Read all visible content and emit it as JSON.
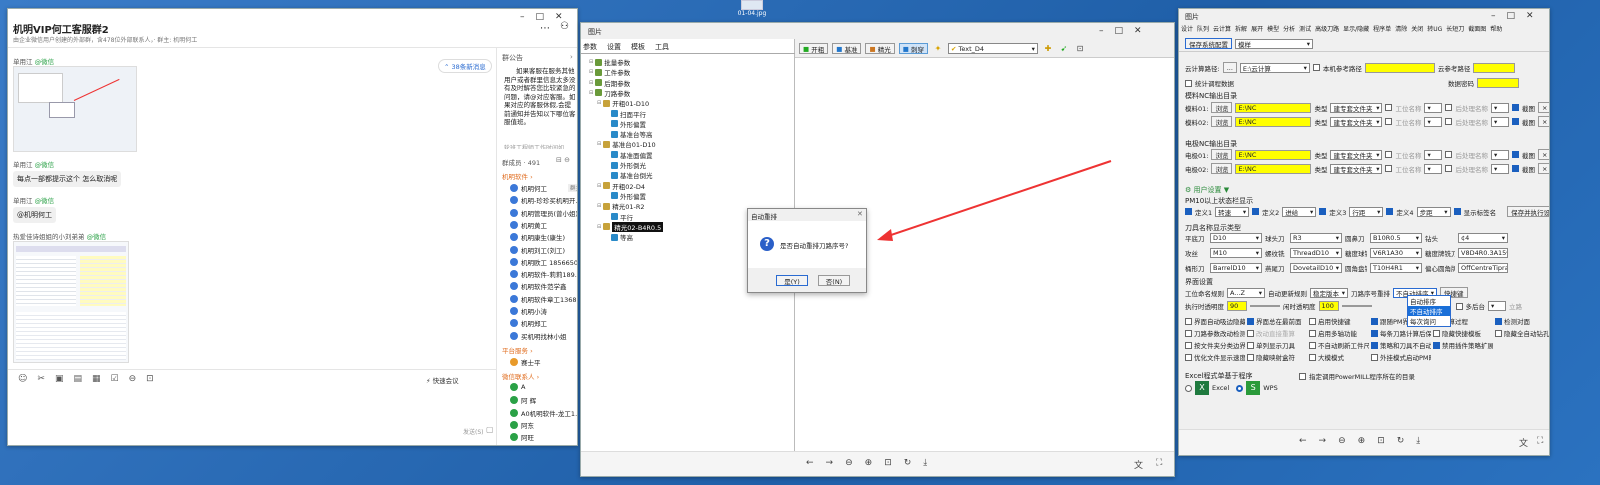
{
  "desktop_file_label": "01-04.jpg",
  "chat": {
    "title": "机明VIP何工客服群2",
    "subtitle": "由企业微信用户创建的外部群，含478位外部联系人，· 群主: 机明何工",
    "new_msgs": "38条新消息",
    "msgs": [
      {
        "sender": "单用江",
        "tag": "@微信"
      },
      {
        "sender": "单用江",
        "tag": "@微信",
        "text": "每点一部都提示这个 怎么取消呢"
      },
      {
        "sender": "单用江",
        "tag": "@微信",
        "text": "@机明何工"
      },
      {
        "sender": "热爱佳诗姐姐的小刘弟弟",
        "tag": "@微信"
      }
    ],
    "quick_meeting": "快速会议",
    "send_hint": "发送(S)",
    "notice_title": "群公告",
    "notice_text": "如果客服在服务其他用户或者群里信息太多没有及时解答您比较紧急的问题，请@对应客服。如果对应的客服休假,会提前通知并告知以下哪位客服值班。",
    "notice_more": "轮班工程师工作时间如",
    "members_title": "群成员 · 491",
    "group_software": "机明软件",
    "members": [
      "机明何工",
      "机明-珍珍买机明开...",
      "机明管理员(曾小姐)",
      "机明黄工",
      "机明康生(康生)",
      "机明刘工(刘工)",
      "机明欧工 1856650...",
      "机明软件-莉莉189...",
      "机明软件范学鑫",
      "机明软件章工1368...",
      "机明小涛",
      "机明郑工",
      "买机明找林小姐"
    ],
    "owner_tag": "群主",
    "group_platform": "平台服务",
    "platform_members": [
      "赛士平"
    ],
    "group_wechat": "微信联系人",
    "wechat_members": [
      "A",
      "阿 辉",
      "A0机明软件-龙工1...",
      "阿东",
      "阿旺"
    ]
  },
  "imgwin": {
    "title": "图片",
    "tabs": [
      "参数",
      "设置",
      "模板",
      "工具"
    ],
    "toolbar": [
      "开粗",
      "基准",
      "精光",
      "刺穿"
    ],
    "select_value": "Text_D4",
    "tree": [
      {
        "label": "批量参数",
        "lvl": 1
      },
      {
        "label": "工件参数",
        "lvl": 1
      },
      {
        "label": "后期参数",
        "lvl": 1
      },
      {
        "label": "刀路参数",
        "lvl": 1
      },
      {
        "label": "开粗01-D10",
        "lvl": 2
      },
      {
        "label": "扫面平行",
        "lvl": 3
      },
      {
        "label": "外形偏置",
        "lvl": 3
      },
      {
        "label": "基准台等高",
        "lvl": 3
      },
      {
        "label": "基准台01-D10",
        "lvl": 2
      },
      {
        "label": "基准面偏置",
        "lvl": 3
      },
      {
        "label": "外形倒光",
        "lvl": 3
      },
      {
        "label": "基准台倒光",
        "lvl": 3
      },
      {
        "label": "开粗02-D4",
        "lvl": 2
      },
      {
        "label": "外形偏置",
        "lvl": 3
      },
      {
        "label": "精光01-R2",
        "lvl": 2
      },
      {
        "label": "平行",
        "lvl": 3
      },
      {
        "label": "精光02-B4R0.5",
        "lvl": 2,
        "selected": true
      },
      {
        "label": "等高",
        "lvl": 3
      }
    ],
    "dialog": {
      "title": "自动重排",
      "question": "是否自动重排刀路序号?",
      "yes": "是(Y)",
      "no": "否(N)"
    }
  },
  "cfg": {
    "title": "图片",
    "menu": [
      "设计",
      "队列",
      "云计算",
      "拆解",
      "展开",
      "模型",
      "分析",
      "测试",
      "高级刀路",
      "显示/隐藏",
      "程序单",
      "清除",
      "关闭",
      "转UG",
      "长短刀",
      "截面图",
      "帮助"
    ],
    "save_btn": "保存系统配置",
    "profile": "模样",
    "cloud_path_label": "云计算路径:",
    "cloud_path": "E:\\云计算",
    "local_ref": "本机参考路径",
    "cloud_ref": "云参考路径",
    "stat_label": "统计调程数据",
    "db_pwd": "数据密码",
    "nc_title": "模料NC输出目录",
    "nc_rows": [
      {
        "label": "模料01:",
        "path": "E:\\NC"
      },
      {
        "label": "模料02:",
        "path": "E:\\NC"
      }
    ],
    "elec_title": "电极NC输出目录",
    "elec_rows": [
      {
        "label": "电极01:",
        "path": "E:\\NC"
      },
      {
        "label": "电极02:",
        "path": "E:\\NC"
      }
    ],
    "browse": "浏览",
    "type_lbl": "类型",
    "type_val": "建专套文件夹",
    "wpos": "工位名称",
    "post": "后处理名称",
    "section": "截图",
    "user_title": "用户设置",
    "pm10_title": "PM10以上状态栏显示",
    "defs": [
      {
        "l": "定义1",
        "v": "转速"
      },
      {
        "l": "定义2",
        "v": "进给"
      },
      {
        "l": "定义3",
        "v": "行距"
      },
      {
        "l": "定义4",
        "v": "步距"
      }
    ],
    "show_tag": "显示标签名",
    "save_exec": "保存并执行设置",
    "tool_title": "刀具名称显示类型",
    "tools1": [
      {
        "l": "平底刀",
        "v": "D10"
      },
      {
        "l": "球头刀",
        "v": "R3"
      },
      {
        "l": "圆鼻刀",
        "v": "B10R0.5"
      },
      {
        "l": "钻头",
        "v": "¢4"
      }
    ],
    "tools2": [
      {
        "l": "攻丝",
        "v": "M10"
      },
      {
        "l": "螺纹铣",
        "v": "ThreadD10"
      },
      {
        "l": "糖度球铣刀",
        "v": "V6R1A30"
      },
      {
        "l": "糖度牌铣刀",
        "v": "V8D4R0.3A15"
      }
    ],
    "tools3": [
      {
        "l": "桶形刀",
        "v": "BarrelD10"
      },
      {
        "l": "燕尾刀",
        "v": "DovetailD10"
      },
      {
        "l": "圆角盘铣刀",
        "v": "T10H4R1"
      },
      {
        "l": "偏心圆角牌铣刀",
        "v": "OffCentreTipra"
      }
    ],
    "ui_title": "界面设置",
    "ui_row1": [
      {
        "l": "工位命名规则",
        "v": "A...Z"
      },
      {
        "l": "自动更新规则",
        "v": "稳定版本"
      },
      {
        "l": "刀路序号重排",
        "v": "不自动排序"
      }
    ],
    "shortcut": "快捷键",
    "dropdown_opts": [
      "自动排序",
      "不自动排序",
      "每次询问"
    ],
    "transp": [
      {
        "l": "执行时透明度",
        "v": "90"
      },
      {
        "l": "闲时透明度",
        "v": "100"
      }
    ],
    "plugin_lbl": "插件透明",
    "multi_lbl": "多后台",
    "expand_lbl": "立路",
    "checks": [
      [
        "界面自动吸边隐藏",
        "界面总在最前面",
        "启用快捷键",
        "跟随PM界面移动",
        "计算过程",
        "检测对面"
      ],
      [
        "刀路参数改动检测",
        "改动直接重算",
        "启用多轴功能",
        "每条刀路计算后保存",
        "隐藏快捷模板",
        "隐藏全自动钻孔"
      ],
      [
        "按文件夹分类边界",
        "单列显示刀具",
        "不自动刷新工件尺寸",
        "策略和刀具不自动弹出",
        "禁用插件策略扩展工具栏"
      ],
      [
        "优化文件显示速度",
        "隐藏映射盒符",
        "大模模式",
        "外挂模式启动PM时加载插件"
      ]
    ],
    "excel_title": "Excel程式单基于程序",
    "excel": "Excel",
    "wps": "WPS",
    "pm_path_lbl": "指定调用PowerMILL程序所在的目录"
  },
  "colors": {
    "yellow": "#ffff00",
    "blue": "#1a5fbf",
    "accent": "#3b78d8"
  }
}
